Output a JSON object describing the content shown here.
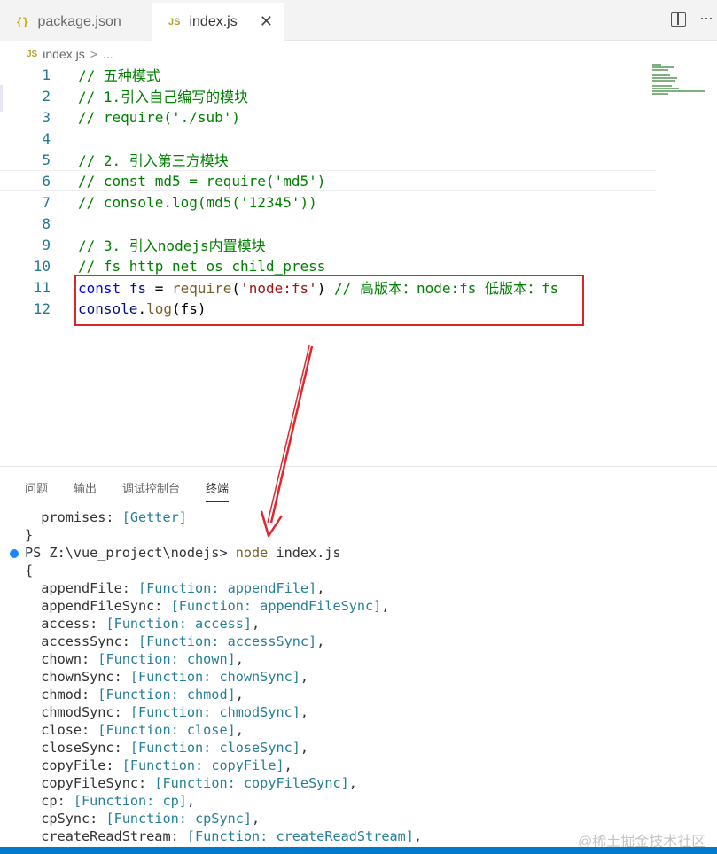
{
  "tabs": [
    {
      "icon": "{}",
      "label": "package.json"
    },
    {
      "icon": "JS",
      "label": "index.js",
      "close": "✕"
    }
  ],
  "toolbar": {
    "more": "···"
  },
  "breadcrumb": {
    "icon": "JS",
    "file": "index.js",
    "sep": ">",
    "rest": "..."
  },
  "editor": {
    "lines": [
      {
        "n": "1",
        "text": "// 五种模式"
      },
      {
        "n": "2",
        "text": "// 1.引入自己编写的模块"
      },
      {
        "n": "3",
        "text": "// require('./sub')"
      },
      {
        "n": "4",
        "text": ""
      },
      {
        "n": "5",
        "text": "// 2. 引入第三方模块"
      },
      {
        "n": "6",
        "text": "// const md5 = require('md5')"
      },
      {
        "n": "7",
        "text": "// console.log(md5('12345'))"
      },
      {
        "n": "8",
        "text": ""
      },
      {
        "n": "9",
        "text": "// 3. 引入nodejs内置模块"
      },
      {
        "n": "10",
        "text": "// fs http net os child_press"
      },
      {
        "n": "11",
        "tokens": {
          "kw": "const",
          "var": "fs",
          "op": " = ",
          "fn": "require",
          "p1": "(",
          "str": "'node:fs'",
          "p2": ")",
          "comment": " // 高版本：node:fs 低版本：fs"
        }
      },
      {
        "n": "12",
        "tokens": {
          "obj": "console",
          "dot": ".",
          "fn": "log",
          "args": "(fs)"
        }
      }
    ]
  },
  "panel": {
    "tabs": [
      "问题",
      "输出",
      "调试控制台",
      "终端"
    ],
    "terminal": [
      {
        "k": "  promises: ",
        "v": "[Getter]",
        "e": ""
      },
      {
        "k": "}",
        "v": "",
        "e": ""
      },
      {
        "prompt": "PS Z:\\vue_project\\nodejs> ",
        "cmd": "node",
        "arg": " index.js"
      },
      {
        "k": "{",
        "v": "",
        "e": ""
      },
      {
        "k": "  appendFile: ",
        "v": "[Function: appendFile]",
        "e": ","
      },
      {
        "k": "  appendFileSync: ",
        "v": "[Function: appendFileSync]",
        "e": ","
      },
      {
        "k": "  access: ",
        "v": "[Function: access]",
        "e": ","
      },
      {
        "k": "  accessSync: ",
        "v": "[Function: accessSync]",
        "e": ","
      },
      {
        "k": "  chown: ",
        "v": "[Function: chown]",
        "e": ","
      },
      {
        "k": "  chownSync: ",
        "v": "[Function: chownSync]",
        "e": ","
      },
      {
        "k": "  chmod: ",
        "v": "[Function: chmod]",
        "e": ","
      },
      {
        "k": "  chmodSync: ",
        "v": "[Function: chmodSync]",
        "e": ","
      },
      {
        "k": "  close: ",
        "v": "[Function: close]",
        "e": ","
      },
      {
        "k": "  closeSync: ",
        "v": "[Function: closeSync]",
        "e": ","
      },
      {
        "k": "  copyFile: ",
        "v": "[Function: copyFile]",
        "e": ","
      },
      {
        "k": "  copyFileSync: ",
        "v": "[Function: copyFileSync]",
        "e": ","
      },
      {
        "k": "  cp: ",
        "v": "[Function: cp]",
        "e": ","
      },
      {
        "k": "  cpSync: ",
        "v": "[Function: cpSync]",
        "e": ","
      },
      {
        "k": "  createReadStream: ",
        "v": "[Function: createReadStream]",
        "e": ","
      }
    ]
  },
  "watermark": "@稀土掘金技术社区",
  "colors": {
    "annotation": "#d9262c",
    "accent": "#007acc"
  }
}
